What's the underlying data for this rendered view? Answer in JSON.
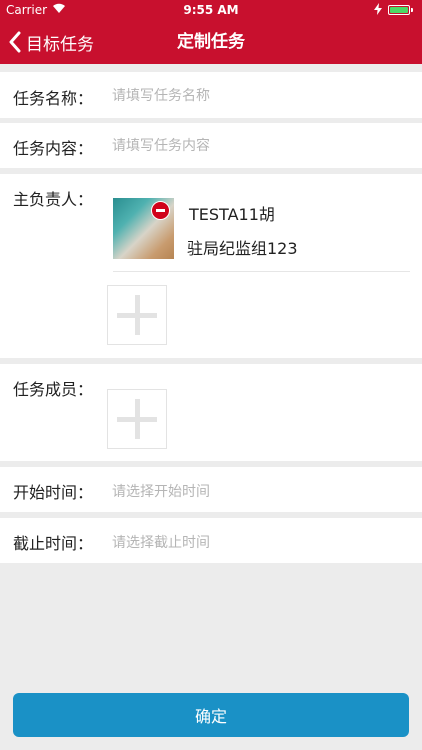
{
  "status_bar": {
    "carrier": "Carrier",
    "time": "9:55 AM"
  },
  "nav": {
    "back_label": "目标任务",
    "title": "定制任务"
  },
  "form": {
    "task_name": {
      "label": "任务名称：",
      "placeholder": "请填写任务名称"
    },
    "task_content": {
      "label": "任务内容：",
      "placeholder": "请填写任务内容"
    },
    "owner": {
      "label": "主负责人：",
      "person": {
        "name": "TESTA11胡",
        "group": "驻局纪监组123"
      }
    },
    "members": {
      "label": "任务成员："
    },
    "start_time": {
      "label": "开始时间：",
      "placeholder": "请选择开始时间"
    },
    "end_time": {
      "label": "截止时间：",
      "placeholder": "请选择截止时间"
    }
  },
  "confirm_label": "确定",
  "colors": {
    "nav": "#c8102e",
    "confirm": "#1a91c6",
    "remove": "#d0021b",
    "background": "#ececec"
  }
}
